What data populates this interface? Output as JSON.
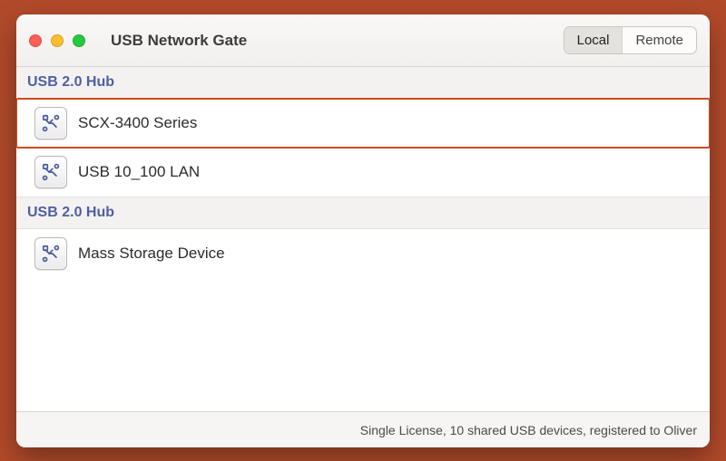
{
  "window": {
    "title": "USB Network Gate"
  },
  "segmented": {
    "local": "Local",
    "remote": "Remote",
    "active": "local"
  },
  "sections": [
    {
      "header": "USB 2.0 Hub",
      "devices": [
        {
          "name": "SCX-3400 Series",
          "highlight": true
        },
        {
          "name": "USB 10_100 LAN",
          "highlight": false
        }
      ]
    },
    {
      "header": "USB 2.0 Hub",
      "devices": [
        {
          "name": "Mass Storage Device",
          "highlight": false
        }
      ]
    }
  ],
  "footer": {
    "status": "Single License, 10 shared USB devices, registered to Oliver"
  }
}
